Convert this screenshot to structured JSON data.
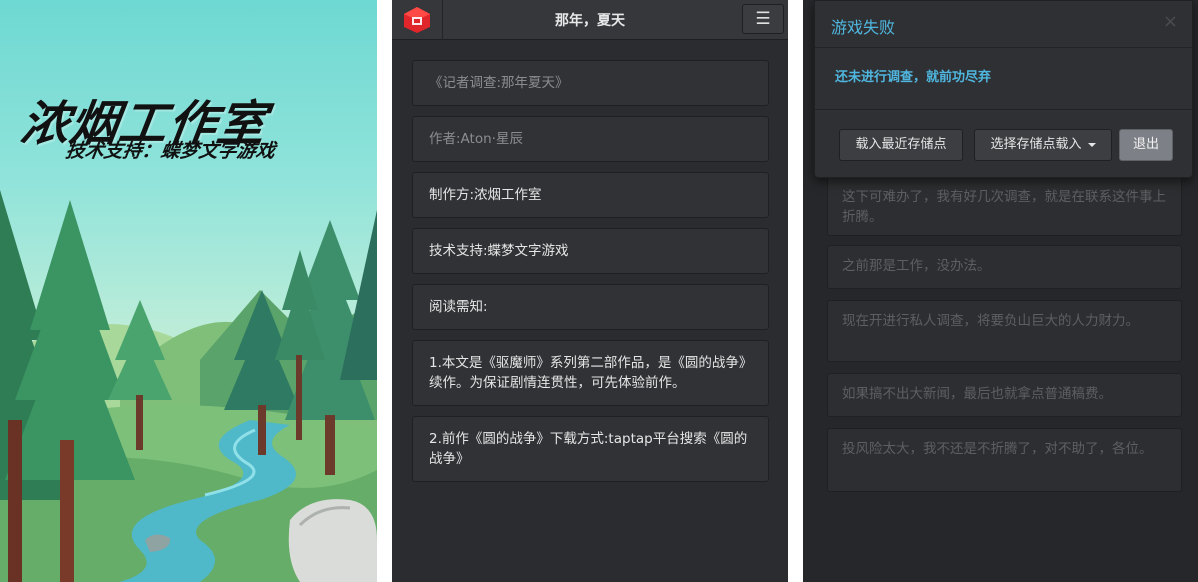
{
  "splash": {
    "title": "浓烟工作室",
    "subtitle": "技术支持：蝶梦文字游戏"
  },
  "reader": {
    "header_title": "那年，夏天",
    "menu_icon": "hamburger-icon",
    "logo_icon": "red-cube-logo",
    "cards": [
      {
        "text": "《记者调查:那年夏天》"
      },
      {
        "text": "作者:Aton·星辰"
      },
      {
        "text": "制作方:浓烟工作室"
      },
      {
        "text": "技术支持:蝶梦文字游戏"
      },
      {
        "text": "阅读需知:"
      },
      {
        "text": "1.本文是《驱魔师》系列第二部作品，是《圆的战争》续作。为保证剧情连贯性，可先体验前作。"
      },
      {
        "text": "2.前作《圆的战争》下载方式:taptap平台搜索《圆的战争》"
      }
    ]
  },
  "game_over": {
    "modal_title": "游戏失败",
    "close_icon": "close-icon",
    "message": "还未进行调查，就前功尽弃",
    "buttons": {
      "load_recent": "载入最近存储点",
      "choose_save": "选择存储点载入",
      "exit": "退出"
    },
    "background_cards": [
      {
        "text": "这下可难办了，我有好几次调查，就是在联系这件事上折腾。"
      },
      {
        "text": "之前那是工作，没办法。"
      },
      {
        "text": "现在开进行私人调查，将要负山巨大的人力财力。"
      },
      {
        "text": "如果搞不出大新闻，最后也就拿点普通稿费。"
      },
      {
        "text": "投风险太大，我不还是不折腾了，对不助了，各位。"
      }
    ]
  },
  "colors": {
    "accent": "#4fb7df",
    "logo_red": "#e0262a",
    "panel_bg": "#2b2c30"
  }
}
